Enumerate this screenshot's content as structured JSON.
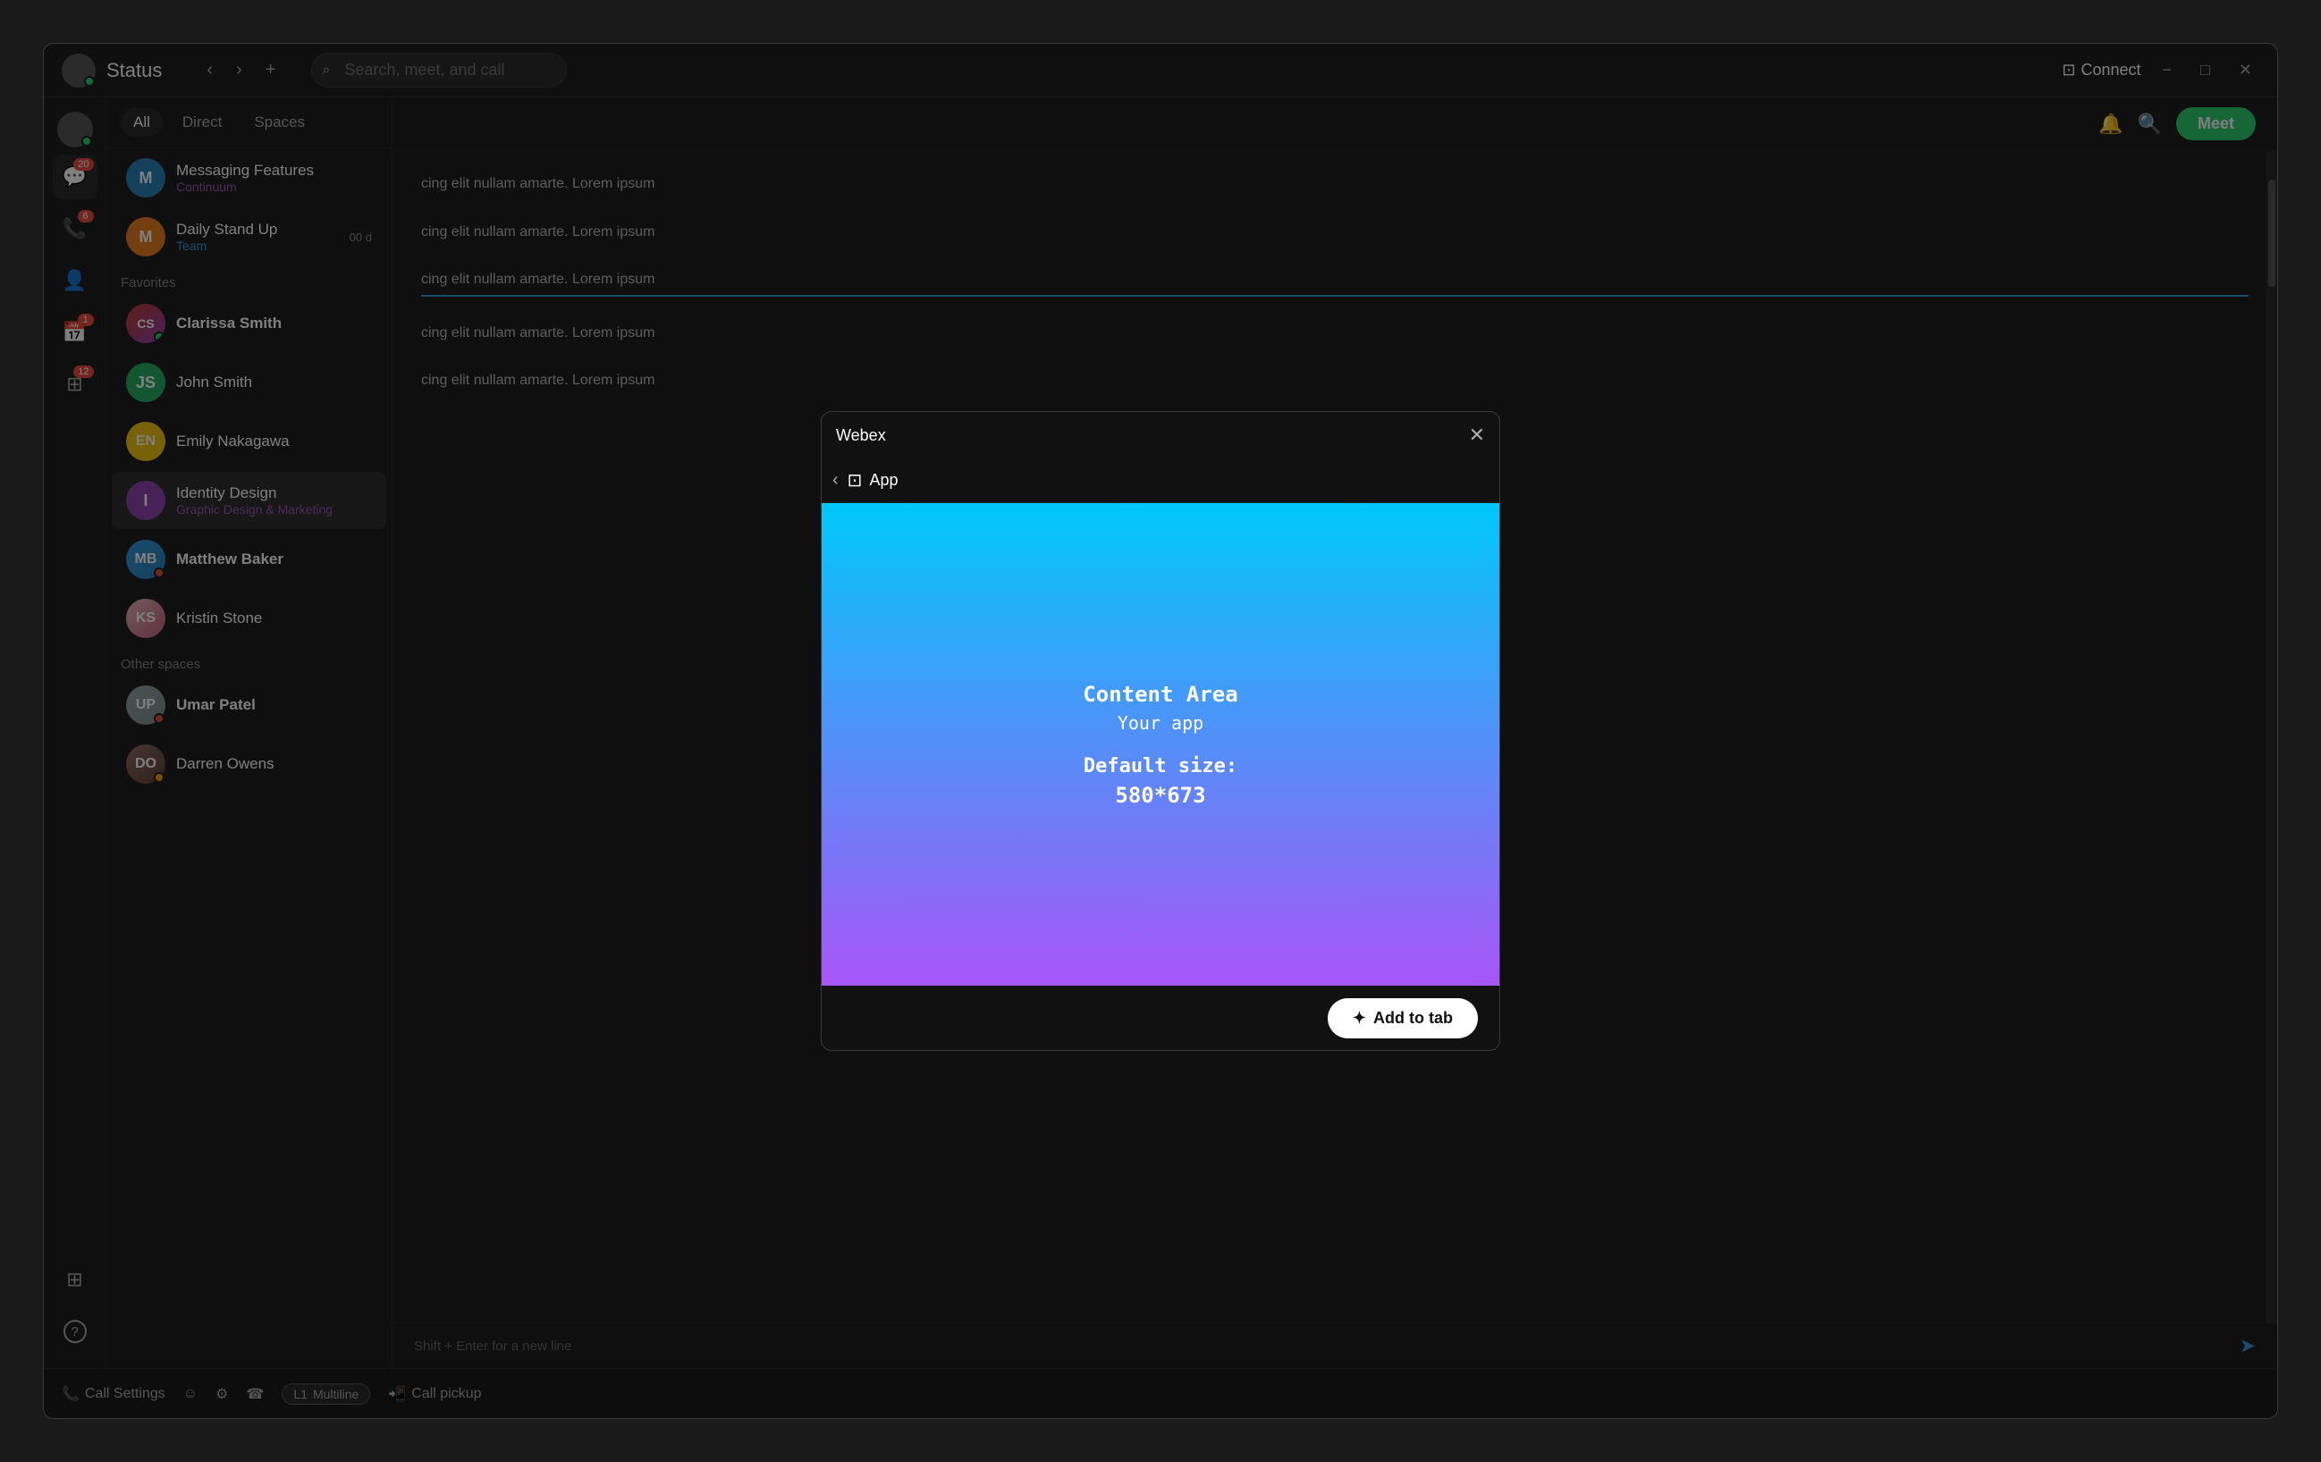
{
  "titleBar": {
    "title": "Status",
    "searchPlaceholder": "Search, meet, and call",
    "connectLabel": "Connect",
    "meetLabel": "Meet",
    "minBtn": "−",
    "maxBtn": "□",
    "closeBtn": "✕"
  },
  "sidebar": {
    "tabs": [
      {
        "label": "All",
        "active": true
      },
      {
        "label": "Direct",
        "active": false
      },
      {
        "label": "Spaces",
        "active": false
      }
    ],
    "favoritesLabel": "Favorites",
    "otherSpacesLabel": "Other spaces",
    "items": [
      {
        "name": "Messaging Features",
        "sub": "Continuum",
        "subColor": "purple",
        "avatar": "M",
        "avatarBg": "#2980b9",
        "time": "",
        "bold": false,
        "type": "space"
      },
      {
        "name": "Daily Stand Up",
        "sub": "Team",
        "subColor": "blue",
        "avatar": "M",
        "avatarBg": "#e67e22",
        "time": "00 d",
        "bold": false,
        "type": "space"
      },
      {
        "name": "Clarissa Smith",
        "sub": "",
        "subColor": "",
        "avatarImg": true,
        "time": "",
        "bold": true,
        "type": "person",
        "status": "online"
      },
      {
        "name": "John Smith",
        "sub": "",
        "subColor": "",
        "avatar": "JS",
        "avatarBg": "#27ae60",
        "time": "",
        "bold": false,
        "type": "person"
      },
      {
        "name": "Emily Nakagawa",
        "sub": "",
        "subColor": "",
        "avatarColor": "#f1c40f",
        "time": "",
        "bold": false,
        "type": "person"
      },
      {
        "name": "Identity Design",
        "sub": "Graphic Design & Marketing",
        "subColor": "purple",
        "avatar": "I",
        "avatarBg": "#8e44ad",
        "time": "",
        "bold": false,
        "type": "space",
        "active": true
      },
      {
        "name": "Matthew Baker",
        "sub": "",
        "subColor": "",
        "avatarImg": true,
        "time": "",
        "bold": true,
        "type": "person"
      },
      {
        "name": "Kristin Stone",
        "sub": "",
        "subColor": "",
        "avatarImg": true,
        "time": "",
        "bold": false,
        "type": "person"
      },
      {
        "name": "Umar Patel",
        "sub": "",
        "subColor": "",
        "avatarImg": true,
        "time": "",
        "bold": true,
        "type": "person"
      },
      {
        "name": "Darren Owens",
        "sub": "",
        "subColor": "",
        "avatarImg": true,
        "time": "",
        "bold": false,
        "type": "person"
      }
    ]
  },
  "icons": {
    "messages": "💬",
    "calls": "📞",
    "teams": "👥",
    "calendar": "📅",
    "addApps": "⊞",
    "help": "?",
    "search": "🔍",
    "bell": "🔔",
    "callSettings": "📞",
    "multiline": "L1",
    "callPickup": "📲"
  },
  "badges": {
    "messages": "20",
    "calls": "6",
    "calendar": "1",
    "teams": "12"
  },
  "messages": [
    "cing elit nullam amarte. Lorem ipsum",
    "cing elit nullam amarte. Lorem ipsum",
    "cing elit nullam amarte. Lorem ipsum",
    "cing elit nullam amarte. Lorem ipsum",
    "cing elit nullam amarte. Lorem ipsum"
  ],
  "footer": {
    "hint": "Shift + Enter for a new line"
  },
  "bottomBar": {
    "callSettings": "Call Settings",
    "multiline": "Multiline",
    "callPickup": "Call pickup"
  },
  "modal": {
    "title": "Webex",
    "closeBtn": "✕",
    "backBtn": "‹",
    "navLabel": "App",
    "contentAreaLabel": "Content Area",
    "yourApp": "Your app",
    "defaultSizeLabel": "Default size:",
    "sizeValue": "580*673",
    "addToTabLabel": "Add to tab",
    "sparkle": "✦"
  }
}
